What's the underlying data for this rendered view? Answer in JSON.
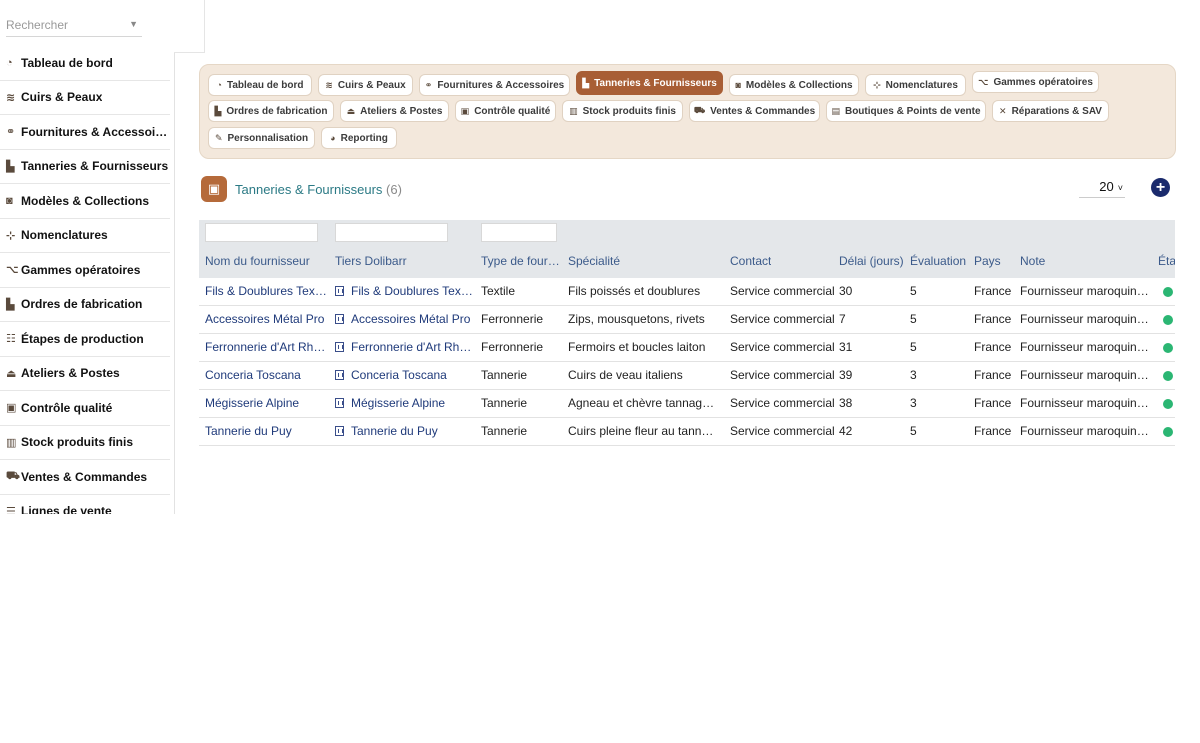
{
  "search": {
    "placeholder": "Rechercher"
  },
  "sidebar": {
    "items": [
      {
        "label": "Tableau de bord",
        "icon": "dashboard-icon",
        "glyph": "◔"
      },
      {
        "label": "Cuirs & Peaux",
        "icon": "layers-icon",
        "glyph": "≋"
      },
      {
        "label": "Fournitures & Accessoires",
        "icon": "link-icon",
        "glyph": "⚭"
      },
      {
        "label": "Tanneries & Fournisseurs",
        "icon": "industry-icon",
        "glyph": "▙"
      },
      {
        "label": "Modèles & Collections",
        "icon": "shopping-bag-icon",
        "glyph": "◙"
      },
      {
        "label": "Nomenclatures",
        "icon": "sitemap-icon",
        "glyph": "⊹"
      },
      {
        "label": "Gammes opératoires",
        "icon": "project-diagram-icon",
        "glyph": "⌥"
      },
      {
        "label": "Ordres de fabrication",
        "icon": "industry-icon",
        "glyph": "▙"
      },
      {
        "label": "Étapes de production",
        "icon": "list-check-icon",
        "glyph": "☷"
      },
      {
        "label": "Ateliers & Postes",
        "icon": "hat-icon",
        "glyph": "⏏"
      },
      {
        "label": "Contrôle qualité",
        "icon": "clipboard-check-icon",
        "glyph": "▣"
      },
      {
        "label": "Stock produits finis",
        "icon": "warehouse-icon",
        "glyph": "▥"
      },
      {
        "label": "Ventes & Commandes",
        "icon": "cart-icon",
        "glyph": "⛟"
      },
      {
        "label": "Lignes de vente",
        "icon": "list-icon",
        "glyph": "☰"
      }
    ]
  },
  "tabs": [
    {
      "label": "Tableau de bord",
      "glyph": "◔",
      "active": false
    },
    {
      "label": "Cuirs & Peaux",
      "glyph": "≋",
      "active": false
    },
    {
      "label": "Fournitures & Accessoires",
      "glyph": "⚭",
      "active": false
    },
    {
      "label": "Tanneries & Fournisseurs",
      "glyph": "▙",
      "active": true
    },
    {
      "label": "Modèles & Collections",
      "glyph": "◙",
      "active": false
    },
    {
      "label": "Nomenclatures",
      "glyph": "⊹",
      "active": false
    },
    {
      "label": "Gammes opératoires",
      "glyph": "⌥",
      "active": false
    },
    {
      "label": "Ordres de fabrication",
      "glyph": "▙",
      "active": false
    },
    {
      "label": "Ateliers & Postes",
      "glyph": "⏏",
      "active": false
    },
    {
      "label": "Contrôle qualité",
      "glyph": "▣",
      "active": false
    },
    {
      "label": "Stock produits finis",
      "glyph": "▥",
      "active": false
    },
    {
      "label": "Ventes & Commandes",
      "glyph": "⛟",
      "active": false
    },
    {
      "label": "Boutiques & Points de vente",
      "glyph": "▤",
      "active": false
    },
    {
      "label": "Réparations & SAV",
      "glyph": "✕",
      "active": false
    },
    {
      "label": "Personnalisation",
      "glyph": "✎",
      "active": false
    },
    {
      "label": "Reporting",
      "glyph": "◕",
      "active": false
    }
  ],
  "header": {
    "title": "Tanneries & Fournisseurs",
    "count": "(6)",
    "limit": "20",
    "colors": {
      "accent": "#a85e35",
      "title": "#2b7a85",
      "status_ok": "#2bb673",
      "add_button": "#1a2a6c"
    }
  },
  "table": {
    "columns": [
      "Nom du fournisseur",
      "Tiers Dolibarr",
      "Type de four…",
      "Spécialité",
      "Contact",
      "Délai (jours)",
      "Évaluation",
      "Pays",
      "Note",
      "État"
    ],
    "rows": [
      {
        "nom": "Fils & Doublures Textile",
        "tiers": "Fils & Doublures Textile",
        "type": "Textile",
        "specialite": "Fils poissés et doublures",
        "contact": "Service commercial",
        "delai": "30",
        "evaluation": "5",
        "pays": "France",
        "note": "Fournisseur maroquinerie",
        "etat": "active"
      },
      {
        "nom": "Accessoires Métal Pro",
        "tiers": "Accessoires Métal Pro",
        "type": "Ferronnerie",
        "specialite": "Zips, mousquetons, rivets",
        "contact": "Service commercial",
        "delai": "7",
        "evaluation": "5",
        "pays": "France",
        "note": "Fournisseur maroquinerie",
        "etat": "active"
      },
      {
        "nom": "Ferronnerie d'Art Rhône",
        "tiers": "Ferronnerie d'Art Rhône",
        "type": "Ferronnerie",
        "specialite": "Fermoirs et boucles laiton",
        "contact": "Service commercial",
        "delai": "31",
        "evaluation": "5",
        "pays": "France",
        "note": "Fournisseur maroquinerie",
        "etat": "active"
      },
      {
        "nom": "Conceria Toscana",
        "tiers": "Conceria Toscana",
        "type": "Tannerie",
        "specialite": "Cuirs de veau italiens",
        "contact": "Service commercial",
        "delai": "39",
        "evaluation": "3",
        "pays": "France",
        "note": "Fournisseur maroquinerie",
        "etat": "active"
      },
      {
        "nom": "Mégisserie Alpine",
        "tiers": "Mégisserie Alpine",
        "type": "Tannerie",
        "specialite": "Agneau et chèvre tannage c…",
        "contact": "Service commercial",
        "delai": "38",
        "evaluation": "3",
        "pays": "France",
        "note": "Fournisseur maroquinerie",
        "etat": "active"
      },
      {
        "nom": "Tannerie du Puy",
        "tiers": "Tannerie du Puy",
        "type": "Tannerie",
        "specialite": "Cuirs pleine fleur au tannag…",
        "contact": "Service commercial",
        "delai": "42",
        "evaluation": "5",
        "pays": "France",
        "note": "Fournisseur maroquinerie",
        "etat": "active"
      }
    ]
  }
}
